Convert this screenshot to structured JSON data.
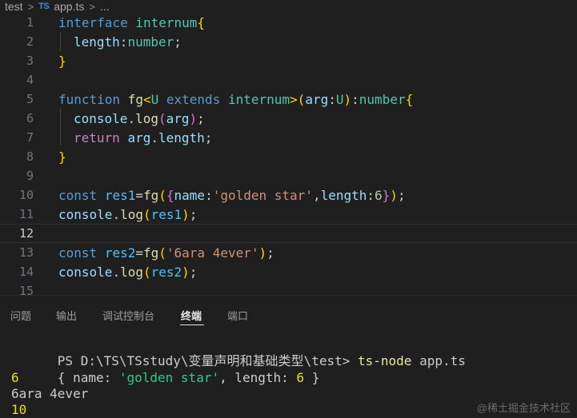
{
  "breadcrumb": {
    "folder": "test",
    "separator": ">",
    "file_badge": "TS",
    "file": "app.ts",
    "ellipsis": "..."
  },
  "editor": {
    "lines": [
      {
        "num": "1"
      },
      {
        "num": "2"
      },
      {
        "num": "3"
      },
      {
        "num": "4"
      },
      {
        "num": "5"
      },
      {
        "num": "6"
      },
      {
        "num": "7"
      },
      {
        "num": "8"
      },
      {
        "num": "9"
      },
      {
        "num": "10"
      },
      {
        "num": "11"
      },
      {
        "num": "12"
      },
      {
        "num": "13"
      },
      {
        "num": "14"
      },
      {
        "num": "15"
      }
    ],
    "tokens": {
      "interface_kw": "interface",
      "iface_name": "internum",
      "brace_open": "{",
      "brace_close": "}",
      "length_prop": "length",
      "colon": ":",
      "number_type": "number",
      "semicolon": ";",
      "function_kw": "function",
      "fn_name": "fg",
      "lt": "<",
      "gt": ">",
      "type_param": "U",
      "extends_kw": "extends",
      "paren_open": "(",
      "paren_close": ")",
      "arg": "arg",
      "console": "console",
      "dot": ".",
      "log": "log",
      "return_kw": "return",
      "length": "length",
      "const_kw": "const",
      "res1": "res1",
      "res2": "res2",
      "eq": "=",
      "name_prop": "name",
      "golden_star": "'golden star'",
      "comma": ",",
      "six": "6",
      "sixara": "'6ara 4ever'",
      "space": " "
    }
  },
  "panel": {
    "tabs": [
      "问题",
      "输出",
      "调试控制台",
      "终端",
      "端口"
    ],
    "active_tab": "终端"
  },
  "terminal": {
    "prompt": "PS D:\\TS\\TSstudy\\变量声明和基础类型\\test> ",
    "command": "ts-node",
    "command_arg": " app.ts",
    "out1_open": "{ name: ",
    "out1_str": "'golden star'",
    "out1_mid": ", length: ",
    "out1_num": "6",
    "out1_close": " }",
    "out2": "6",
    "out3": "6ara 4ever",
    "out4": "10"
  },
  "watermark": "@稀土掘金技术社区",
  "colors": {
    "background": "#1f1f1f",
    "keyword": "#569cd6",
    "function": "#dcdcaa",
    "type": "#4ec9b0",
    "variable": "#9cdcfe",
    "string": "#ce9178",
    "number": "#b5cea8"
  }
}
